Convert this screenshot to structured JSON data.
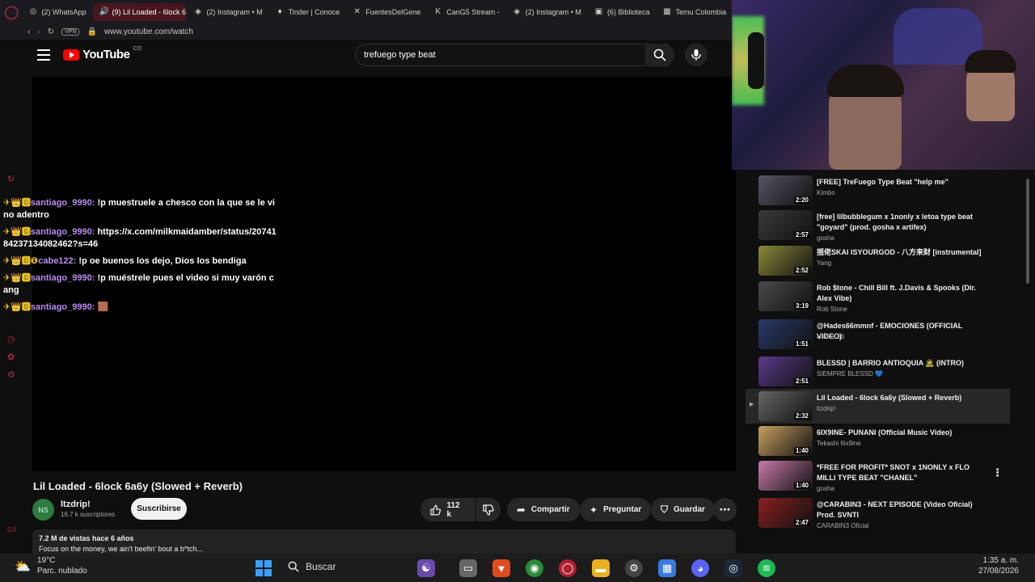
{
  "browser": {
    "tabs": [
      {
        "label": "(2) WhatsApp",
        "icon": "whatsapp-icon",
        "glyph": "◎"
      },
      {
        "label": "(9) Lil Loaded - 6lock 6",
        "icon": "speaker-icon",
        "glyph": "🔊",
        "active": true
      },
      {
        "label": "(2) Instagram • M",
        "icon": "instagram-icon",
        "glyph": "◈"
      },
      {
        "label": "Tinder | Conoce",
        "icon": "tinder-icon",
        "glyph": "♦"
      },
      {
        "label": "FuentesDelGene",
        "icon": "x-icon",
        "glyph": "✕"
      },
      {
        "label": "CanG5 Stream -",
        "icon": "kick-icon",
        "glyph": "K"
      },
      {
        "label": "(2) Instagram • M",
        "icon": "instagram-icon",
        "glyph": "◈"
      },
      {
        "label": "(6) Biblioteca",
        "icon": "biblioteca-icon",
        "glyph": "▣"
      },
      {
        "label": "Temu Colombia",
        "icon": "temu-icon",
        "glyph": "▦"
      }
    ],
    "vpn_label": "VPN",
    "url": "www.youtube.com/watch"
  },
  "youtube": {
    "logo_text": "YouTube",
    "country": "CO",
    "search_value": "trefuego type beat"
  },
  "chat": [
    {
      "badges": "✈👑🅱",
      "user": "santiago_9990:",
      "text": " !p muestruele a chesco con la que se le vino adentro"
    },
    {
      "badges": "✈👑🅱",
      "user": "santiago_9990:",
      "text": " https://x.com/milkmaidamber/status/2074184237134082462?s=46"
    },
    {
      "badges": "✈👑🅱❶",
      "user": "cabe122:",
      "text": " !p oe buenos los dejo, Dios los bendiga"
    },
    {
      "badges": "✈👑🅱",
      "user": "santiago_9990:",
      "text": " !p muéstrele pues el video si muy varón cang"
    },
    {
      "badges": "✈👑🅱",
      "user": "santiago_9990:",
      "text": " 🟫"
    }
  ],
  "video": {
    "title": "Lil Loaded - 6lock 6a6y (Slowed + Reverb)",
    "channel": "ltzdrip!",
    "avatar_text": "NS",
    "subscribers": "16.7 k suscriptores",
    "subscribe_label": "Suscribirse",
    "likes": "112 k",
    "share_label": "Compartir",
    "ask_label": "Preguntar",
    "save_label": "Guardar",
    "views_line": "7.2 M de vistas  hace 6 años",
    "description": "Focus on the money, we ain't beefin' bout a b*tch..."
  },
  "related": [
    {
      "title": "[FREE] TreFuego Type Beat \"help me\"",
      "channel": "Kimbo",
      "duration": "2:20",
      "color": "#555566"
    },
    {
      "title": "[free] lilbubblegum x 1nonly x letoa type beat \"goyard\" (prod. gosha x artifex)",
      "channel": "gosha",
      "duration": "2:57",
      "color": "#3a3a3a"
    },
    {
      "title": "揺佬SKAI ISYOURGOD - 八方来财 [instrumental]",
      "channel": "Yang",
      "duration": "2:52",
      "color": "#8a8a3a"
    },
    {
      "title": "Rob $tone - Chill Bill ft. J.Davis & Spooks (Dir. Alex Vibe)",
      "channel": "Rob Stone",
      "duration": "3:19",
      "color": "#4a4a4a"
    },
    {
      "title": "@Hades66mmnf - EMOCIONES (OFFICIAL VIDEO)",
      "channel": "Hades 66",
      "duration": "1:51",
      "color": "#2a3a6a"
    },
    {
      "title": "BLESSD | BARRIO ANTIOQUIA 🧟 (INTRO)",
      "channel": "SIEMPRE BLESSD 💙",
      "duration": "2:51",
      "color": "#5a3a8a"
    },
    {
      "title": "Lil Loaded - 6lock 6a6y (Slowed + Reverb)",
      "channel": "ltzdrip!",
      "duration": "2:32",
      "color": "#666666",
      "active": true
    },
    {
      "title": "6IX9INE- PUNANI (Official Music Video)",
      "channel": "Tekashi 6ix9ine",
      "duration": "1:40",
      "color": "#c8a060"
    },
    {
      "title": "*FREE FOR PROFIT* SNOT x 1NONLY x FLO MILLI TYPE BEAT \"CHANEL\"",
      "channel": "gosha",
      "duration": "1:40",
      "color": "#c87aa8"
    },
    {
      "title": "@CARABIN3 - NEXT EPISODE (Video Oficial) Prod. SVNTI",
      "channel": "CARABIN3 Oficial",
      "duration": "2:47",
      "color": "#8a2020"
    }
  ],
  "taskbar": {
    "temperature": "19°C",
    "weather": "Parc. nublado",
    "search_label": "Buscar",
    "time": "1:35 a. m.",
    "date": "27/08/2026"
  }
}
